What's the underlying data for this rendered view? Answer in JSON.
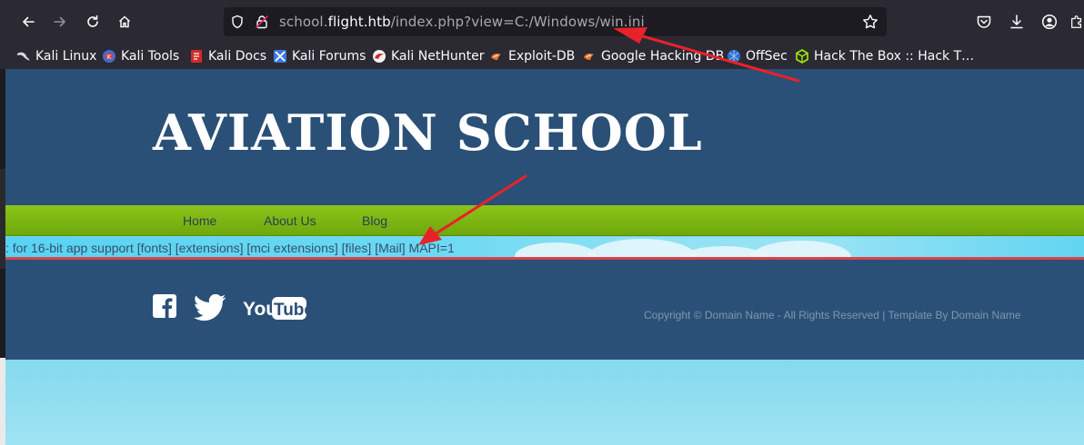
{
  "browser": {
    "url": {
      "prefix": "school.",
      "domain": "flight.htb",
      "path": "/index.php?view=C:/Windows/win.ini"
    }
  },
  "bookmarks": [
    {
      "label": "Kali Linux",
      "icon": "kali-dragon-icon"
    },
    {
      "label": "Kali Tools",
      "icon": "kali-tools-icon"
    },
    {
      "label": "Kali Docs",
      "icon": "kali-docs-icon"
    },
    {
      "label": "Kali Forums",
      "icon": "kali-forums-icon"
    },
    {
      "label": "Kali NetHunter",
      "icon": "nethunter-icon"
    },
    {
      "label": "Exploit-DB",
      "icon": "exploitdb-icon"
    },
    {
      "label": "Google Hacking DB",
      "icon": "ghdb-icon"
    },
    {
      "label": "OffSec",
      "icon": "offsec-icon"
    },
    {
      "label": "Hack The Box :: Hack T…",
      "icon": "htb-icon"
    }
  ],
  "site": {
    "title": "AVIATION SCHOOL",
    "nav": [
      "Home",
      "About Us",
      "Blog"
    ],
    "content": ": for 16-bit app support [fonts] [extensions] [mci extensions] [files] [Mail] MAPI=1",
    "social": [
      "facebook-icon",
      "twitter-icon",
      "youtube-icon"
    ],
    "youtube": {
      "you": "You",
      "tube": "Tube"
    },
    "copyright": "Copyright © Domain Name - All Rights Reserved | Template By Domain Name"
  },
  "colors": {
    "header": "#2a5077",
    "nav": "#7fb813",
    "sky": "#7fd6ec",
    "arrow": "#e8222a"
  }
}
